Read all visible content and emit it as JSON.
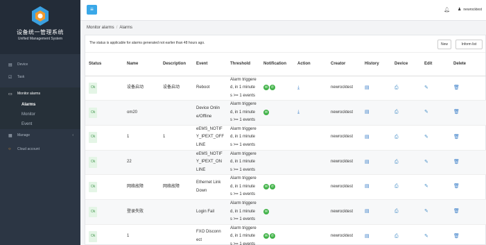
{
  "brand": {
    "title_cn": "设备统一管理系统",
    "title_en": "Unified Management System"
  },
  "sidebar": {
    "items": [
      {
        "label": "Device",
        "icon": "device-icon"
      },
      {
        "label": "Task",
        "icon": "task-icon"
      },
      {
        "label": "Monitor alarms",
        "icon": "monitor-icon"
      },
      {
        "label": "Manage",
        "icon": "manage-icon"
      },
      {
        "label": "Cloud account",
        "icon": "cloud-icon"
      }
    ],
    "sub_items": [
      "Alarms",
      "Monitor",
      "Event"
    ]
  },
  "header": {
    "user": "newrocktest"
  },
  "breadcrumb": {
    "parent": "Monitor alarms",
    "separator": "/",
    "current": "Alarms"
  },
  "notice": "The status is applicable for alarms generated not earlier than 48 hours ago.",
  "buttons": {
    "new": "New",
    "inform": "Inform list"
  },
  "table": {
    "headers": [
      "Status",
      "Name",
      "Description",
      "Event",
      "Threshold",
      "Notification",
      "Action",
      "Creator",
      "History",
      "Device",
      "Edit",
      "Delete"
    ],
    "rows": [
      {
        "status": "Ok",
        "name": "设备启动",
        "desc": "设备启动",
        "event": "Reboot",
        "thr1": "Alarm triggere",
        "thr2": "d, in 1 minute",
        "thr3": "s >= 1 events",
        "notif": 2,
        "action": true,
        "creator": "newrocktest"
      },
      {
        "status": "Ok",
        "name": "om20",
        "desc": "",
        "event": "Device Onlin e/Offline",
        "thr1": "Alarm triggere",
        "thr2": "d, in 1 minute",
        "thr3": "s >= 1 events",
        "notif": 1,
        "action": true,
        "creator": "newrocktest"
      },
      {
        "status": "Ok",
        "name": "1",
        "desc": "1",
        "event": "eEMS_NOTIF Y_IPEXT_OFF LINE",
        "thr1": "Alarm triggere",
        "thr2": "d, in 1 minute",
        "thr3": "s >= 1 events",
        "notif": 0,
        "action": false,
        "creator": "newrocktest"
      },
      {
        "status": "Ok",
        "name": "22",
        "desc": "",
        "event": "eEMS_NOTIF Y_IPEXT_ON LINE",
        "thr1": "Alarm triggere",
        "thr2": "d, in 1 minute",
        "thr3": "s >= 1 events",
        "notif": 0,
        "action": false,
        "creator": "newrocktest"
      },
      {
        "status": "Ok",
        "name": "网络故障",
        "desc": "网络故障",
        "event": "Ethernet Link Down",
        "thr1": "Alarm triggere",
        "thr2": "d, in 1 minute",
        "thr3": "s >= 1 events",
        "notif": 2,
        "action": false,
        "creator": "newrocktest"
      },
      {
        "status": "Ok",
        "name": "登录失败",
        "desc": "",
        "event": "Login Fail",
        "thr1": "Alarm triggere",
        "thr2": "d, in 1 minute",
        "thr3": "s >= 1 events",
        "notif": 1,
        "action": false,
        "creator": "newrocktest"
      },
      {
        "status": "Ok",
        "name": "1",
        "desc": "",
        "event": "FXO Disconn ect",
        "thr1": "Alarm triggere",
        "thr2": "d, in 1 minute",
        "thr3": "s >= 1 events",
        "notif": 2,
        "action": false,
        "creator": "newrocktest"
      }
    ]
  }
}
